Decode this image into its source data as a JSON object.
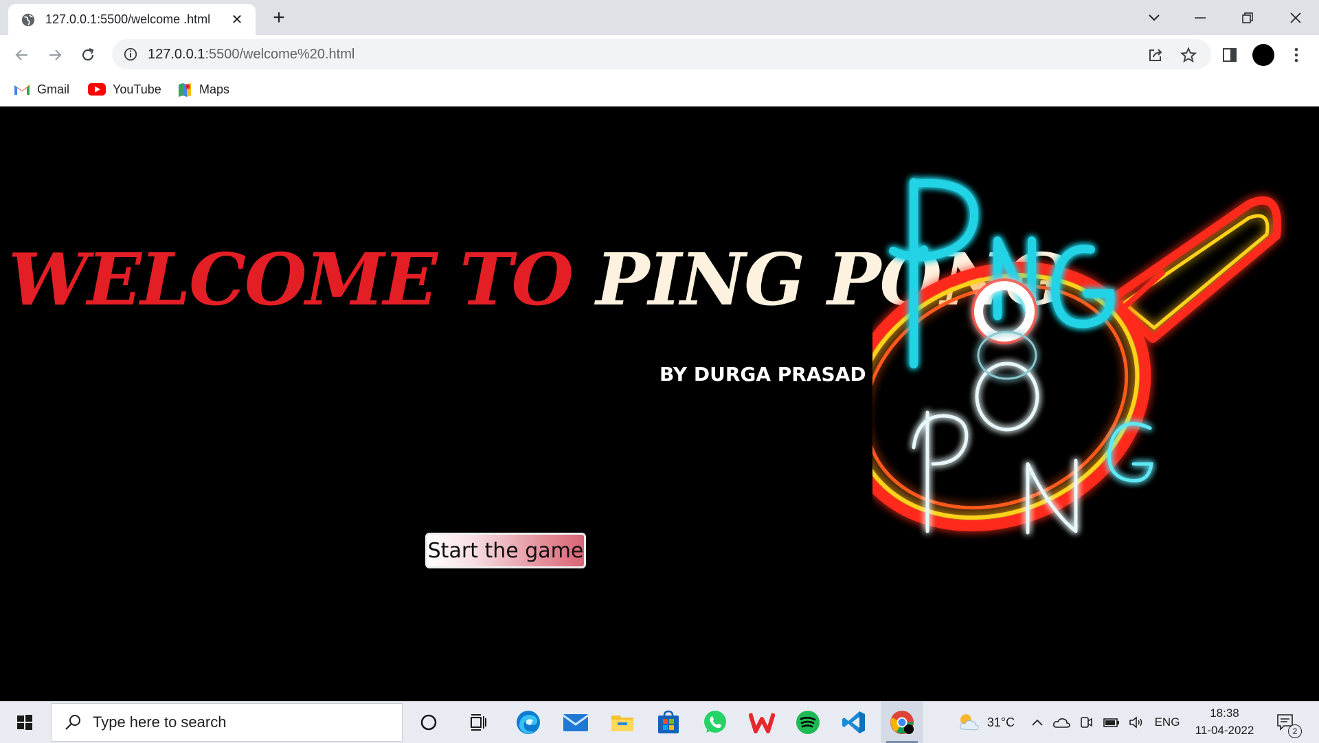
{
  "browser": {
    "tab_title": "127.0.0.1:5500/welcome .html",
    "url_host": "127.0.0.1",
    "url_path": ":5500/welcome%20.html",
    "bookmarks": [
      {
        "label": "Gmail",
        "icon": "gmail-icon"
      },
      {
        "label": "YouTube",
        "icon": "youtube-icon"
      },
      {
        "label": "Maps",
        "icon": "maps-icon"
      }
    ]
  },
  "page": {
    "headline_part1": "WELCOME TO",
    "headline_part2": "PING PONG",
    "byline": "BY DURGA PRASAD",
    "start_button": "Start the game",
    "logo_top_word_letters": [
      "P",
      "N",
      "G"
    ],
    "logo_bottom_word_letters": [
      "P",
      "N",
      "G"
    ],
    "colors": {
      "headline_red": "#e31e24",
      "headline_cream": "#fdf2df",
      "neon_cyan": "#22d3e6",
      "neon_red": "#ff2a1a",
      "neon_yellow": "#ffd21a"
    }
  },
  "taskbar": {
    "search_placeholder": "Type here to search",
    "weather": "31°C",
    "language": "ENG",
    "time": "18:38",
    "date": "11-04-2022",
    "notification_count": "2",
    "apps": [
      "cortana-icon",
      "task-view-icon",
      "edge-icon",
      "mail-icon",
      "file-explorer-icon",
      "store-icon",
      "whatsapp-icon",
      "wps-icon",
      "spotify-icon",
      "vscode-icon",
      "chrome-icon"
    ]
  }
}
